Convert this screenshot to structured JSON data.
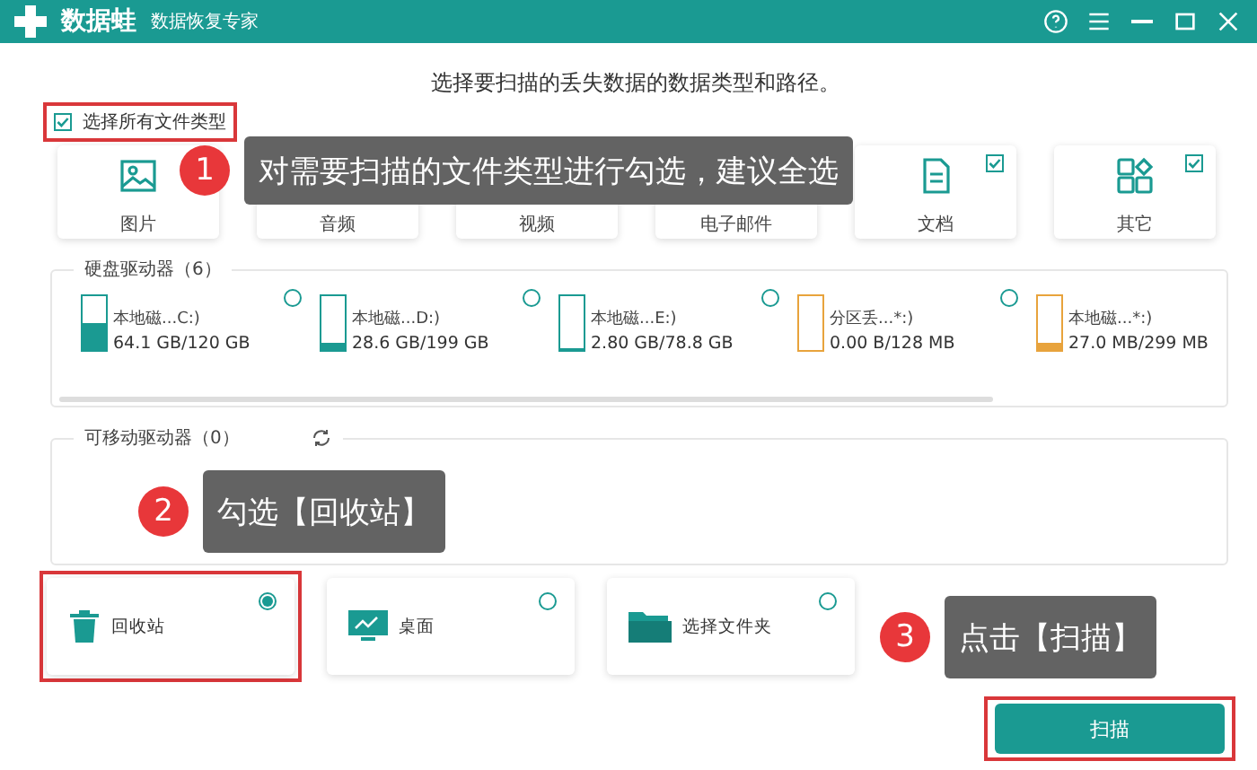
{
  "window": {
    "app_name": "数据蛙",
    "subtitle": "数据恢复专家"
  },
  "heading": "选择要扫描的丢失数据的数据类型和路径。",
  "select_all": {
    "label": "选择所有文件类型",
    "checked": true,
    "highlighted": true
  },
  "file_types": [
    {
      "label": "图片",
      "kind": "image"
    },
    {
      "label": "音频",
      "kind": "audio"
    },
    {
      "label": "视频",
      "kind": "video"
    },
    {
      "label": "电子邮件",
      "kind": "email"
    },
    {
      "label": "文档",
      "kind": "document",
      "checked": true
    },
    {
      "label": "其它",
      "kind": "other",
      "checked": true
    }
  ],
  "hard_drives": {
    "title": "硬盘驱动器（6）",
    "drives": [
      {
        "name": "本地磁...C:)",
        "usage": "64.1 GB/120 GB",
        "level": 0.5,
        "color": "#1a9a92",
        "selected": false
      },
      {
        "name": "本地磁...D:)",
        "usage": "28.6 GB/199 GB",
        "level": 0.15,
        "color": "#1a9a92",
        "selected": false
      },
      {
        "name": "本地磁...E:)",
        "usage": "2.80 GB/78.8 GB",
        "level": 0.05,
        "color": "#1a9a92",
        "selected": false
      },
      {
        "name": "分区丢...*:)",
        "usage": "0.00  B/128 MB",
        "level": 0,
        "color": "#e8a33c",
        "selected": false
      },
      {
        "name": "本地磁...*:)",
        "usage": "27.0 MB/299 MB",
        "level": 0.12,
        "color": "#e8a33c"
      }
    ]
  },
  "removable_drives": {
    "title": "可移动驱动器（0）"
  },
  "locations": [
    {
      "label": "回收站",
      "kind": "trash",
      "selected": true,
      "highlighted": true
    },
    {
      "label": "桌面",
      "kind": "desktop",
      "selected": false,
      "highlighted": false
    },
    {
      "label": "选择文件夹",
      "kind": "folder",
      "selected": false,
      "highlighted": false
    }
  ],
  "scan_button": {
    "label": "扫描",
    "highlighted": true
  },
  "callouts": [
    {
      "number": "1",
      "text": "对需要扫描的文件类型进行勾选，建议全选"
    },
    {
      "number": "2",
      "text": "勾选【回收站】"
    },
    {
      "number": "3",
      "text": "点击【扫描】"
    }
  ]
}
